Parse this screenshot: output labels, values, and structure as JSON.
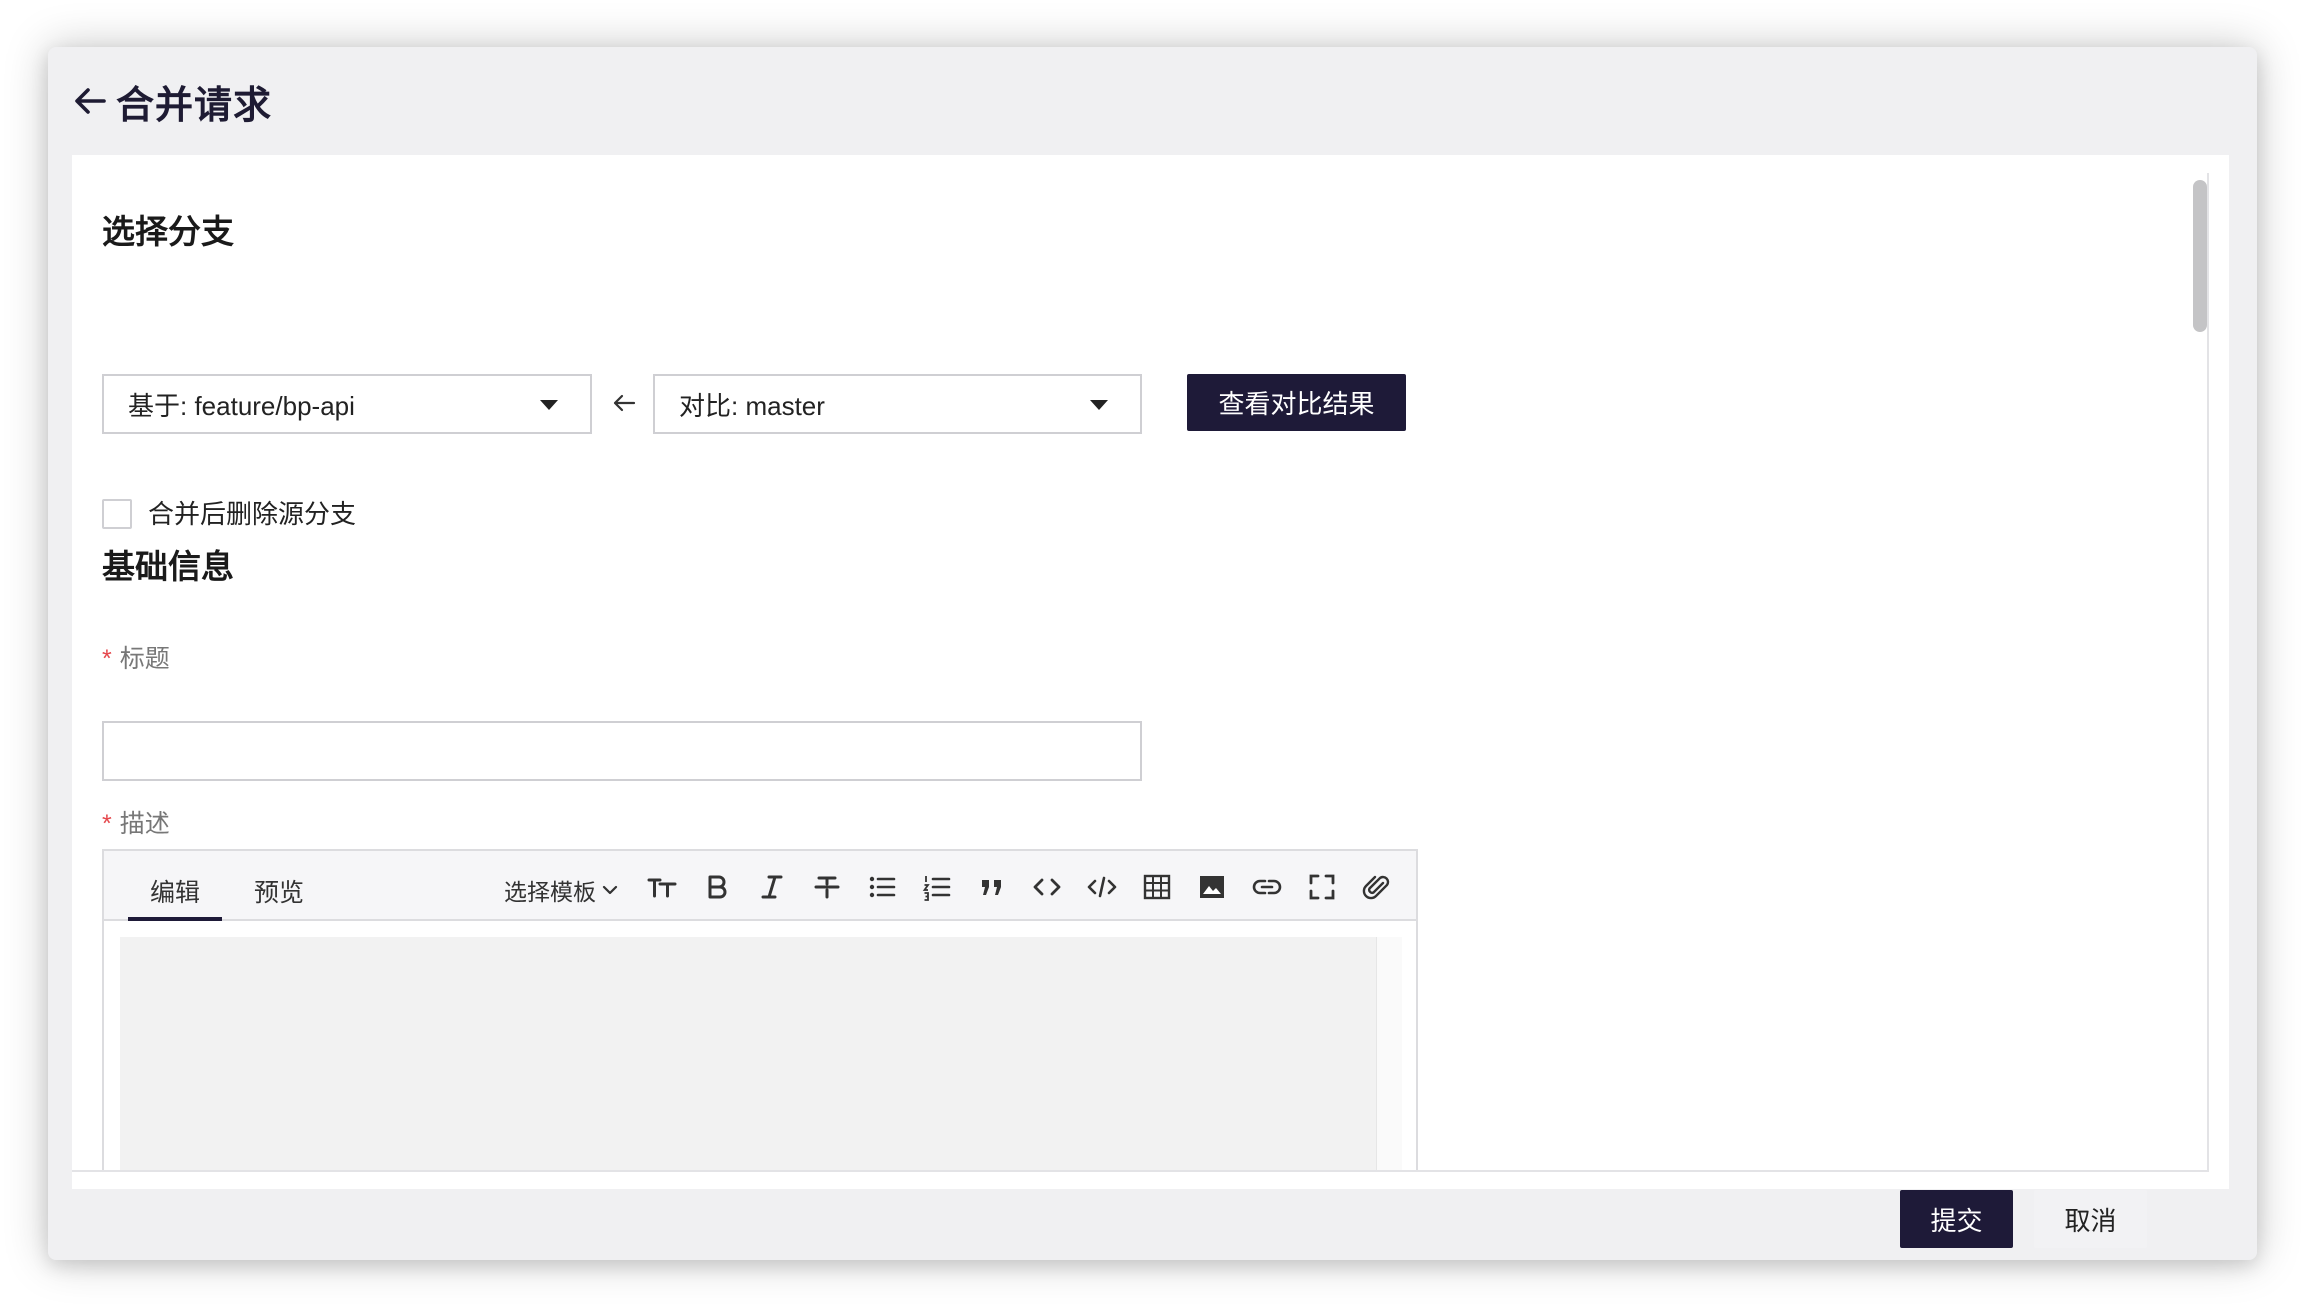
{
  "header": {
    "title": "合并请求"
  },
  "branch_section": {
    "title": "选择分支",
    "base_select": "基于: feature/bp-api",
    "compare_select": "对比: master",
    "compare_button": "查看对比结果",
    "delete_source_label": "合并后删除源分支",
    "delete_source_checked": false
  },
  "info_section": {
    "title": "基础信息",
    "title_field": {
      "required_mark": "*",
      "label": "标题",
      "value": ""
    },
    "description_field": {
      "required_mark": "*",
      "label": "描述"
    }
  },
  "editor": {
    "tabs": [
      {
        "label": "编辑",
        "active": true
      },
      {
        "label": "预览",
        "active": false
      }
    ],
    "template_label": "选择模板",
    "tools": [
      "text-size-icon",
      "bold-icon",
      "italic-icon",
      "strikethrough-icon",
      "bullet-list-icon",
      "numbered-list-icon",
      "quote-icon",
      "code-icon",
      "code-block-icon",
      "table-icon",
      "image-icon",
      "link-icon",
      "fullscreen-icon",
      "attachment-icon"
    ]
  },
  "footer": {
    "submit": "提交",
    "cancel": "取消"
  },
  "colors": {
    "primary": "#1e1a38",
    "required": "#e5484d",
    "window_bg": "#f0f0f2"
  }
}
